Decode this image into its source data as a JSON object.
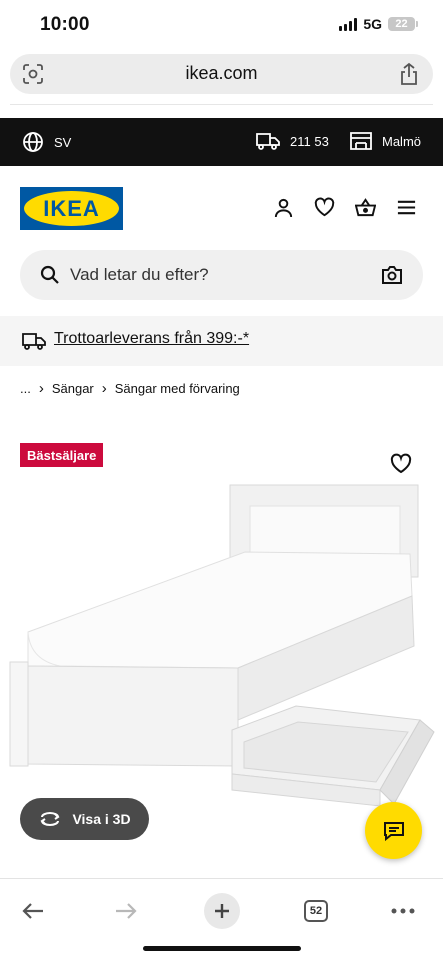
{
  "status": {
    "time": "10:00",
    "network": "5G",
    "battery": "22"
  },
  "browser": {
    "url": "ikea.com",
    "tab_count": "52"
  },
  "topbar": {
    "language": "SV",
    "postal_code": "211 53",
    "store": "Malmö"
  },
  "header": {
    "logo_text": "IKEA"
  },
  "search": {
    "placeholder": "Vad letar du efter?"
  },
  "delivery": {
    "text": "Trottoarleverans från 399:-*"
  },
  "breadcrumb": {
    "ellipsis": "...",
    "items": [
      "Sängar",
      "Sängar med förvaring"
    ]
  },
  "product": {
    "badge": "Bästsäljare",
    "view_3d_label": "Visa i 3D"
  },
  "colors": {
    "ikea_blue": "#0058a3",
    "ikea_yellow": "#ffdb00",
    "badge_red": "#cc0a3d",
    "topbar_bg": "#111111"
  },
  "icons": [
    "scan-icon",
    "share-icon",
    "globe-icon",
    "truck-icon",
    "store-icon",
    "user-icon",
    "heart-icon",
    "basket-icon",
    "menu-icon",
    "search-icon",
    "camera-icon",
    "rotate-icon",
    "chat-icon",
    "back-arrow-icon",
    "forward-arrow-icon",
    "plus-icon",
    "more-icon"
  ]
}
